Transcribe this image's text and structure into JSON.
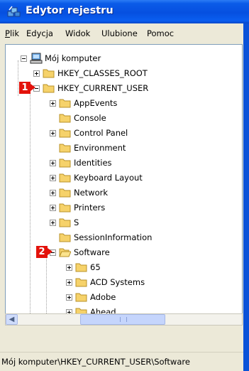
{
  "window": {
    "title": "Edytor rejestru"
  },
  "menu": [
    {
      "label": "Plik"
    },
    {
      "label": "Edycja"
    },
    {
      "label": "Widok"
    },
    {
      "label": "Ulubione"
    },
    {
      "label": "Pomoc"
    }
  ],
  "tree": {
    "root": "Mój komputer",
    "hkcr": "HKEY_CLASSES_ROOT",
    "hkcu": "HKEY_CURRENT_USER",
    "hkcu_children": [
      "AppEvents",
      "Console",
      "Control Panel",
      "Environment",
      "Identities",
      "Keyboard Layout",
      "Network",
      "Printers",
      "S",
      "SessionInformation",
      "Software"
    ],
    "software_children": [
      "65",
      "ACD Systems",
      "Adobe",
      "Ahead"
    ]
  },
  "markers": [
    "1",
    "2"
  ],
  "status": {
    "path": "Mój komputer\\HKEY_CURRENT_USER\\Software"
  },
  "colors": {
    "title_bar": "#0650e0",
    "marker": "#e3120b",
    "folder": "#f6d26a"
  }
}
